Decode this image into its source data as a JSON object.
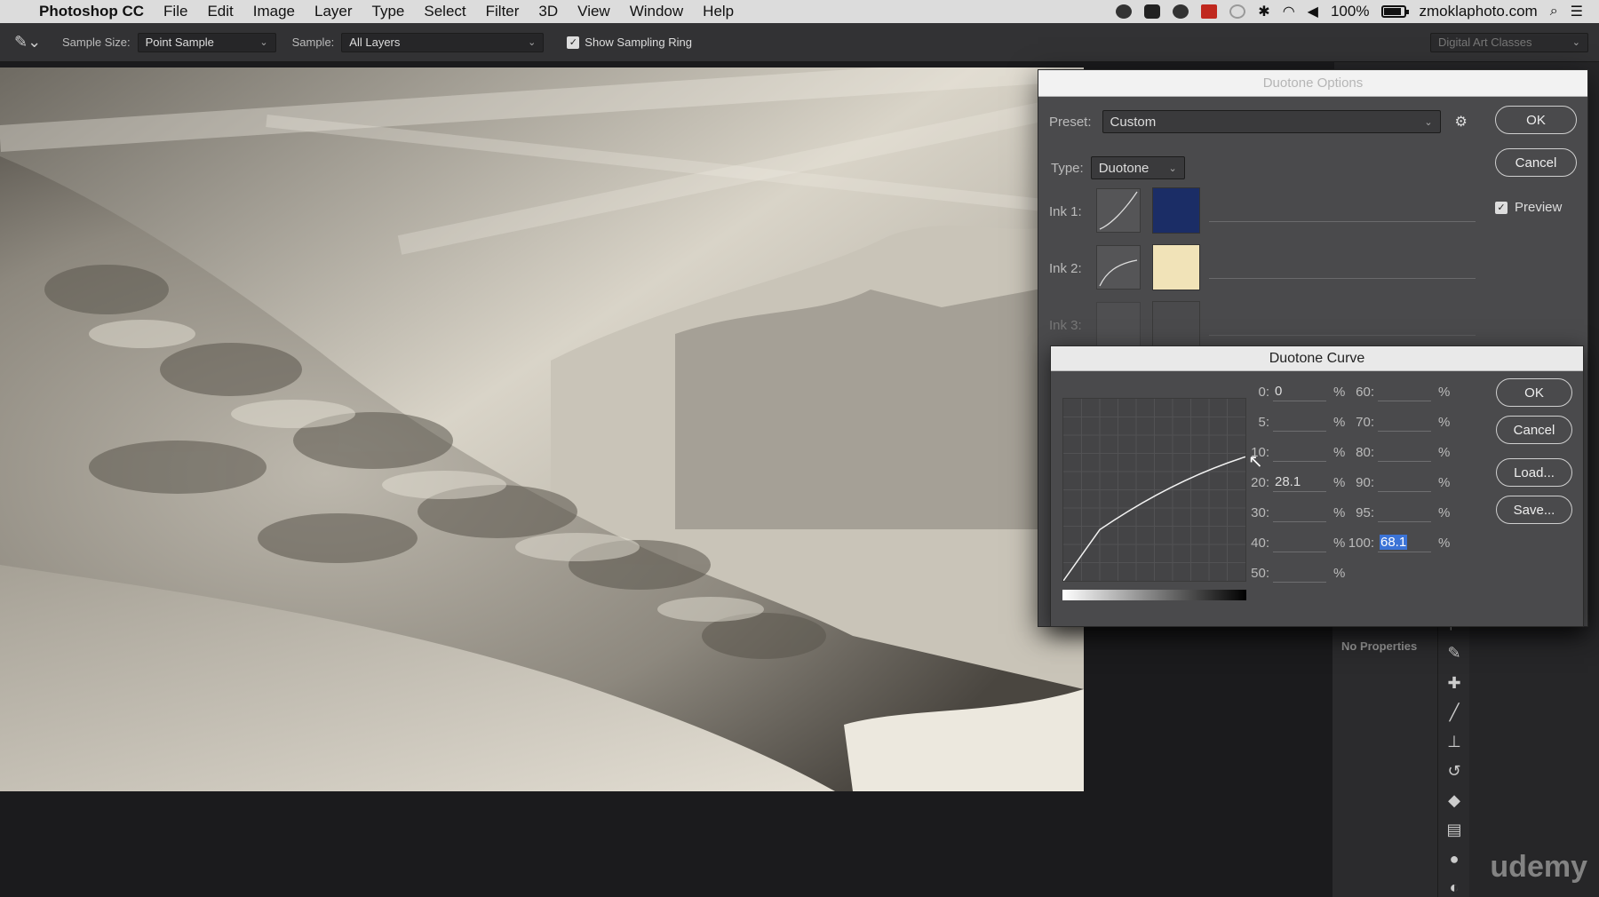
{
  "menubar": {
    "app_name": "Photoshop CC",
    "items": [
      "File",
      "Edit",
      "Image",
      "Layer",
      "Type",
      "Select",
      "Filter",
      "3D",
      "View",
      "Window",
      "Help"
    ],
    "battery": "100%",
    "site": "zmoklaphoto.com",
    "battery_level": 0.85
  },
  "options": {
    "sample_size_label": "Sample Size:",
    "sample_size_value": "Point Sample",
    "sample_label": "Sample:",
    "sample_value": "All Layers",
    "show_ring_label": "Show Sampling Ring",
    "workspace": "Digital Art Classes"
  },
  "duotone": {
    "title": "Duotone Options",
    "preset_label": "Preset:",
    "preset_value": "Custom",
    "type_label": "Type:",
    "type_value": "Duotone",
    "ok": "OK",
    "cancel": "Cancel",
    "preview_label": "Preview",
    "inks": [
      {
        "label": "Ink 1:",
        "color": "#1b2d66"
      },
      {
        "label": "Ink 2:",
        "color": "#f1e3b8"
      },
      {
        "label": "Ink 3:",
        "color": "#4a4a4c"
      }
    ]
  },
  "curve": {
    "title": "Duotone Curve",
    "ok": "OK",
    "cancel": "Cancel",
    "load": "Load...",
    "save": "Save...",
    "pct": "%",
    "left_fields": [
      {
        "label": "0:",
        "value": "0"
      },
      {
        "label": "5:",
        "value": ""
      },
      {
        "label": "10:",
        "value": ""
      },
      {
        "label": "20:",
        "value": "28.1"
      },
      {
        "label": "30:",
        "value": ""
      },
      {
        "label": "40:",
        "value": ""
      },
      {
        "label": "50:",
        "value": ""
      }
    ],
    "right_fields": [
      {
        "label": "60:",
        "value": ""
      },
      {
        "label": "70:",
        "value": ""
      },
      {
        "label": "80:",
        "value": ""
      },
      {
        "label": "90:",
        "value": ""
      },
      {
        "label": "95:",
        "value": ""
      },
      {
        "label": "100:",
        "value": "68.1"
      }
    ]
  },
  "panel": {
    "no_properties": "No Properties"
  },
  "watermark": "udemy"
}
